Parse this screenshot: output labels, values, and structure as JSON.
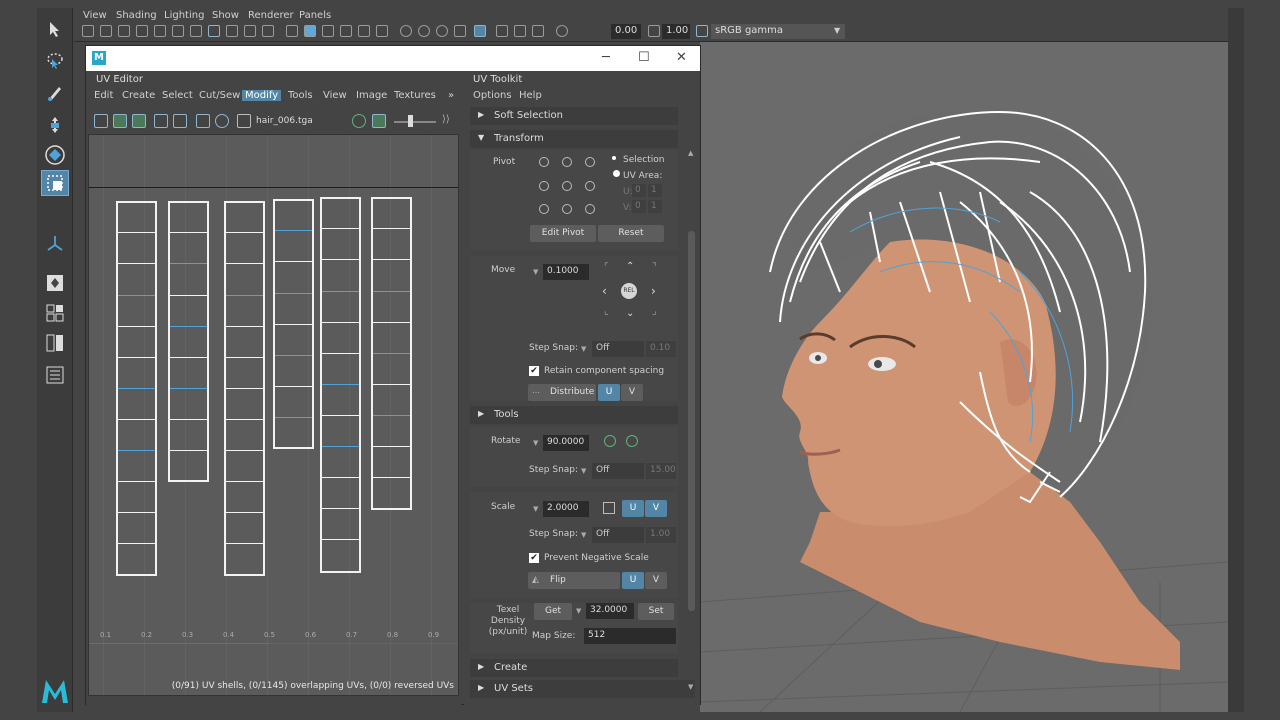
{
  "viewport": {
    "menu": [
      "View",
      "Shading",
      "Lighting",
      "Show",
      "Renderer",
      "Panels"
    ],
    "field_a": "0.00",
    "field_b": "1.00",
    "gamma": "sRGB gamma"
  },
  "uv_editor": {
    "window_logo": "M",
    "title": "UV Editor",
    "menu": [
      "Edit",
      "Create",
      "Select",
      "Cut/Sew",
      "Modify",
      "Tools",
      "View",
      "Image",
      "Textures"
    ],
    "active_menu": "Modify",
    "texture_name": "hair_006.tga",
    "ticks": [
      "0.1",
      "0.2",
      "0.3",
      "0.4",
      "0.5",
      "0.6",
      "0.7",
      "0.8",
      "0.9"
    ],
    "status": "(0/91) UV shells, (0/1145) overlapping UVs, (0/0) reversed UVs"
  },
  "toolkit": {
    "title": "UV Toolkit",
    "menu": [
      "Options",
      "Help"
    ],
    "soft_selection": "Soft Selection",
    "transform": "Transform",
    "pivot_label": "Pivot",
    "pivot_selection": "Selection",
    "pivot_uv_area": "UV Area:",
    "u_label": "U:",
    "v_label": "V:",
    "uv_area_values": [
      "0",
      "1",
      "0",
      "1"
    ],
    "edit_pivot": "Edit Pivot",
    "reset": "Reset",
    "move_label": "Move",
    "move_value": "0.1000",
    "rel_label": "REL",
    "step_snap_label": "Step Snap:",
    "step_snap_off": "Off",
    "move_snap_value": "0.10",
    "retain_spacing": "Retain component spacing",
    "distribute": "Distribute",
    "u": "U",
    "v": "V",
    "tools": "Tools",
    "rotate_label": "Rotate",
    "rotate_value": "90.0000",
    "rotate_snap_value": "15.00",
    "scale_label": "Scale",
    "scale_value": "2.0000",
    "scale_snap_value": "1.00",
    "prevent_negative": "Prevent Negative Scale",
    "flip": "Flip",
    "texel_density": "Texel\nDensity\n(px/unit)",
    "get": "Get",
    "texel_value": "32.0000",
    "set": "Set",
    "map_size_label": "Map Size:",
    "map_size": "512",
    "create": "Create",
    "uv_sets": "UV Sets"
  },
  "colors": {
    "accent": "#5285a6",
    "uv_line": "#f2f2f2",
    "uv_blue": "#4fa3d8",
    "skin": "#c98c6c"
  }
}
